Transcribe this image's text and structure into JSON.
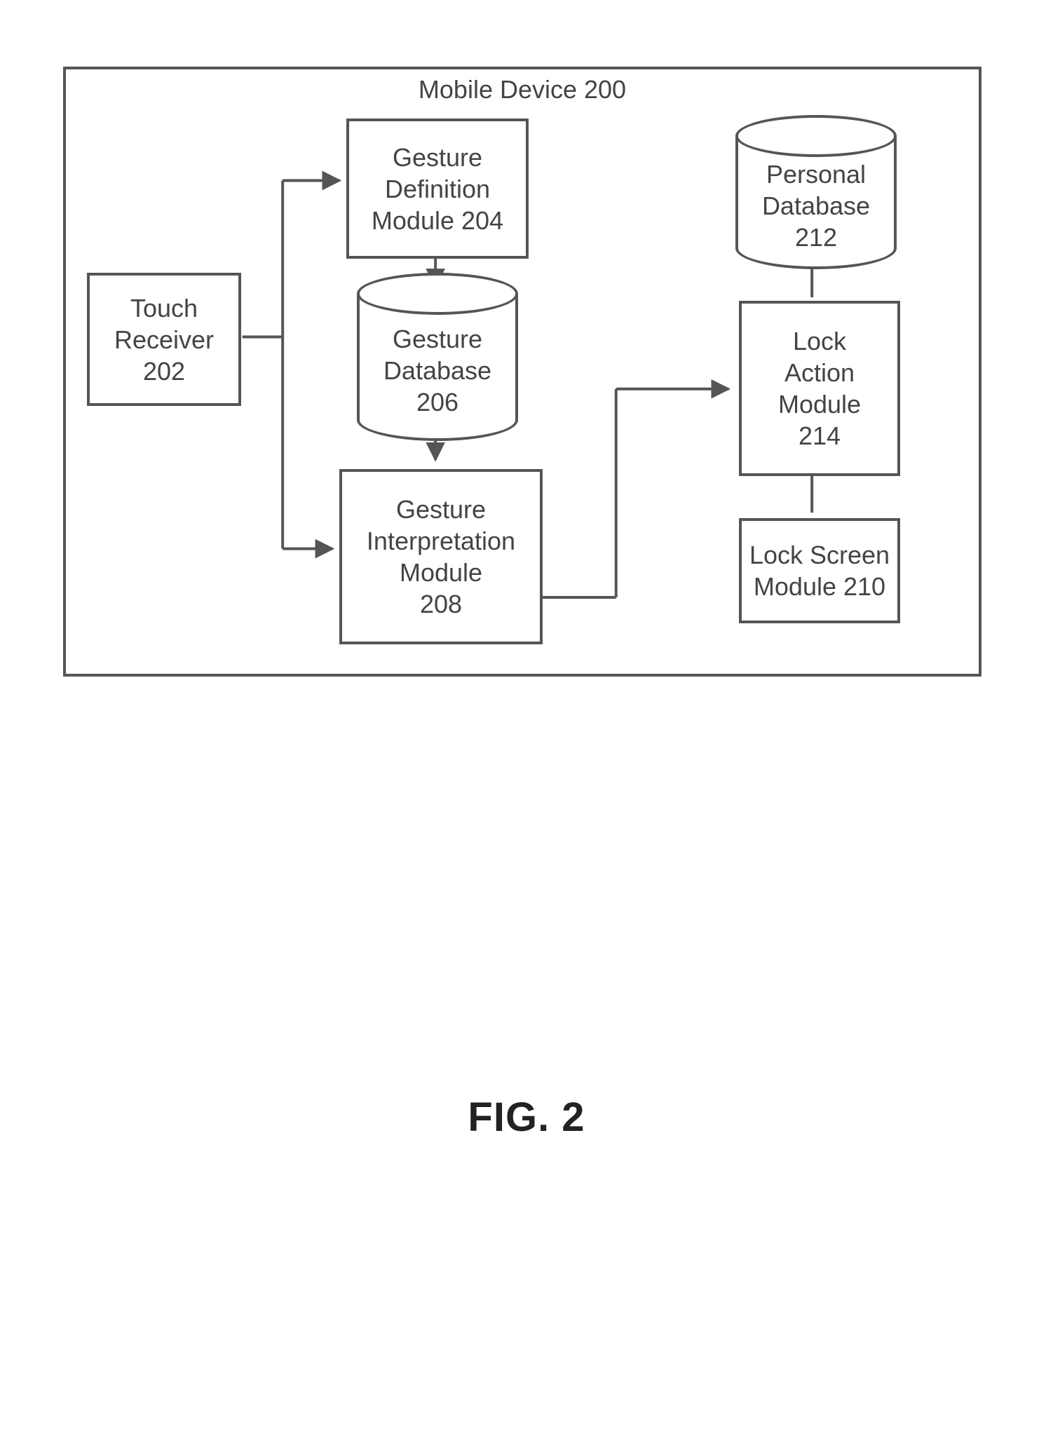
{
  "figure_caption": "FIG. 2",
  "container": {
    "title": "Mobile Device 200"
  },
  "blocks": {
    "touch_receiver": {
      "l1": "Touch",
      "l2": "Receiver",
      "l3": "202"
    },
    "gesture_def": {
      "l1": "Gesture",
      "l2": "Definition",
      "l3": "Module 204"
    },
    "gesture_db": {
      "l1": "Gesture",
      "l2": "Database",
      "l3": "206"
    },
    "gesture_interp": {
      "l1": "Gesture",
      "l2": "Interpretation",
      "l3": "Module",
      "l4": "208"
    },
    "personal_db": {
      "l1": "Personal",
      "l2": "Database",
      "l3": "212"
    },
    "lock_action": {
      "l1": "Lock",
      "l2": "Action",
      "l3": "Module",
      "l4": "214"
    },
    "lock_screen": {
      "l1": "Lock Screen",
      "l2": "Module 210"
    }
  },
  "chart_data": {
    "type": "block-diagram",
    "title": "Mobile Device 200",
    "nodes": [
      {
        "id": "touch_receiver",
        "label": "Touch Receiver 202",
        "kind": "module"
      },
      {
        "id": "gesture_def",
        "label": "Gesture Definition Module 204",
        "kind": "module"
      },
      {
        "id": "gesture_db",
        "label": "Gesture Database 206",
        "kind": "database"
      },
      {
        "id": "gesture_interp",
        "label": "Gesture Interpretation Module 208",
        "kind": "module"
      },
      {
        "id": "personal_db",
        "label": "Personal Database 212",
        "kind": "database"
      },
      {
        "id": "lock_action",
        "label": "Lock Action Module 214",
        "kind": "module"
      },
      {
        "id": "lock_screen",
        "label": "Lock Screen Module 210",
        "kind": "module"
      }
    ],
    "edges": [
      {
        "from": "touch_receiver",
        "to": "gesture_def",
        "directed": true
      },
      {
        "from": "touch_receiver",
        "to": "gesture_interp",
        "directed": true
      },
      {
        "from": "gesture_def",
        "to": "gesture_db",
        "directed": true
      },
      {
        "from": "gesture_db",
        "to": "gesture_interp",
        "directed": true
      },
      {
        "from": "gesture_interp",
        "to": "lock_action",
        "directed": true
      },
      {
        "from": "personal_db",
        "to": "lock_action",
        "directed": false
      },
      {
        "from": "lock_action",
        "to": "lock_screen",
        "directed": false
      }
    ]
  }
}
